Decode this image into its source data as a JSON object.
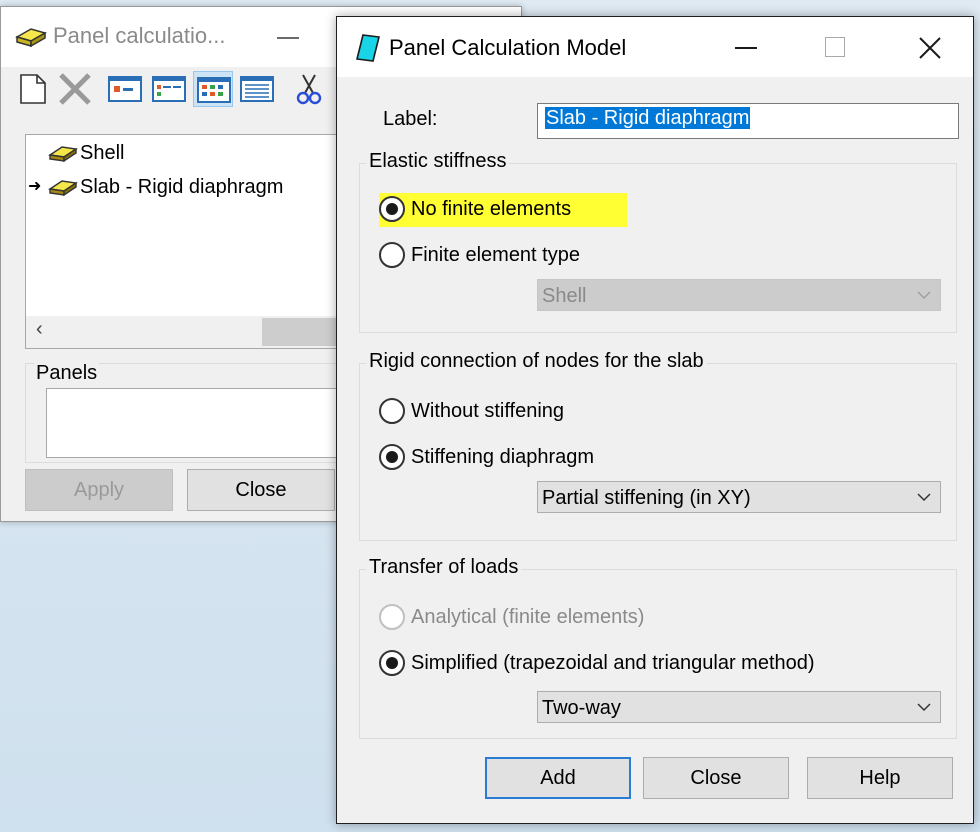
{
  "back_window": {
    "title": "Panel calculatio...",
    "toolbar": [
      "new-icon",
      "delete-icon",
      "view-large-icon",
      "view-small-icon",
      "view-list-icon",
      "view-details-icon",
      "cut-icon"
    ],
    "tree_items": [
      {
        "label": "Shell",
        "current": false
      },
      {
        "label": "Slab - Rigid diaphragm",
        "current": true
      }
    ],
    "panels_label": "Panels",
    "apply_label": "Apply",
    "close_label": "Close"
  },
  "dialog": {
    "title": "Panel Calculation Model",
    "label_caption": "Label:",
    "label_value": "Slab - Rigid diaphragm",
    "elastic": {
      "title": "Elastic stiffness",
      "no_fe": "No finite elements",
      "fe_type": "Finite element type",
      "fe_type_value": "Shell"
    },
    "rigid": {
      "title": "Rigid connection of nodes for the slab",
      "without": "Without stiffening",
      "diaphragm": "Stiffening diaphragm",
      "diaphragm_value": "Partial stiffening (in XY)"
    },
    "transfer": {
      "title": "Transfer of loads",
      "analytical": "Analytical (finite elements)",
      "simplified": "Simplified (trapezoidal and triangular method)",
      "simplified_value": "Two-way"
    },
    "buttons": {
      "add": "Add",
      "close": "Close",
      "help": "Help"
    }
  },
  "colors": {
    "highlight": "#ffff33",
    "selection": "#0078d7",
    "default_button_border": "#2b7bd4"
  }
}
